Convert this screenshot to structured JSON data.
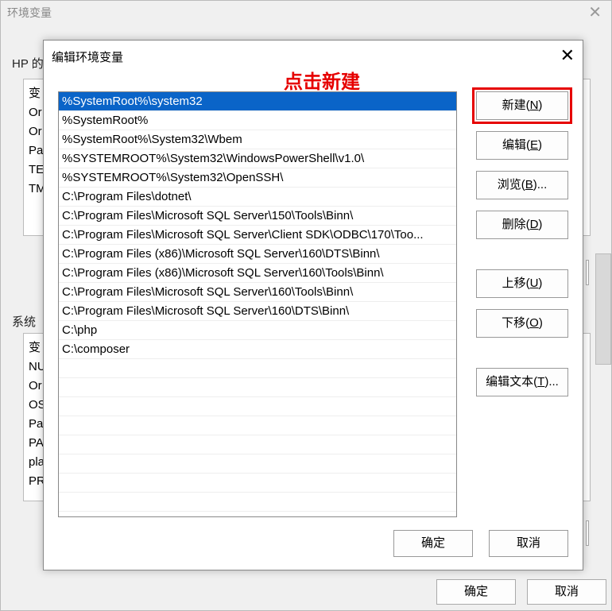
{
  "outer": {
    "title": "环境变量",
    "userGroupLabel": "HP 的",
    "sysGroupLabel": "系统",
    "userVarsCol": "变\nOr\nOr\nPa\nTE\nTM",
    "sysVarsCol": "变\nNU\nOr\nOS\nPa\nPA\npla\nPR",
    "ok": "确定",
    "cancel": "取消"
  },
  "annotation": "点击新建",
  "inner": {
    "title": "编辑环境变量",
    "items": [
      "%SystemRoot%\\system32",
      "%SystemRoot%",
      "%SystemRoot%\\System32\\Wbem",
      "%SYSTEMROOT%\\System32\\WindowsPowerShell\\v1.0\\",
      "%SYSTEMROOT%\\System32\\OpenSSH\\",
      "C:\\Program Files\\dotnet\\",
      "C:\\Program Files\\Microsoft SQL Server\\150\\Tools\\Binn\\",
      "C:\\Program Files\\Microsoft SQL Server\\Client SDK\\ODBC\\170\\Too...",
      "C:\\Program Files (x86)\\Microsoft SQL Server\\160\\DTS\\Binn\\",
      "C:\\Program Files (x86)\\Microsoft SQL Server\\160\\Tools\\Binn\\",
      "C:\\Program Files\\Microsoft SQL Server\\160\\Tools\\Binn\\",
      "C:\\Program Files\\Microsoft SQL Server\\160\\DTS\\Binn\\",
      "C:\\php",
      "C:\\composer"
    ],
    "selectedIndex": 0,
    "buttons": {
      "new": {
        "label": "新建",
        "hotkey": "N"
      },
      "edit": {
        "label": "编辑",
        "hotkey": "E"
      },
      "browse": {
        "label": "浏览",
        "hotkey": "B",
        "suffix": "..."
      },
      "delete": {
        "label": "删除",
        "hotkey": "D"
      },
      "up": {
        "label": "上移",
        "hotkey": "U"
      },
      "down": {
        "label": "下移",
        "hotkey": "O"
      },
      "text": {
        "label": "编辑文本",
        "hotkey": "T",
        "suffix": "..."
      }
    },
    "ok": "确定",
    "cancel": "取消"
  }
}
